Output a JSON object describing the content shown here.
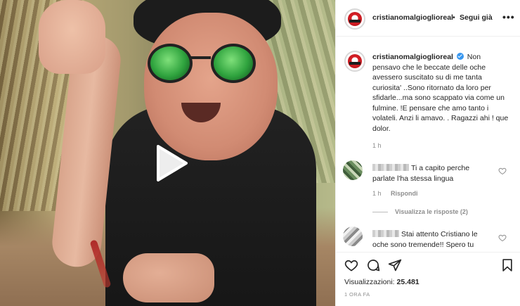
{
  "post": {
    "username": "cristianomalgioglioreal",
    "header_separator": "•",
    "follow_label": "Segui già",
    "more_label": "•••",
    "caption": "Non pensavo che le beccate delle oche avessero suscitato su di me tanta curiosita' ..Sono ritornato da loro per sfidarle...ma sono scappato via come un fulmine. !E pensare che amo tanto i volateli. Anzi li amavo. . Ragazzi ahi ! que dolor.",
    "caption_time": "1 h"
  },
  "comments": [
    {
      "text": "Ti a capito perche parlate l'ha stessa lingua",
      "time": "1 h",
      "reply_label": "Rispondi",
      "view_replies_label": "Visualizza le risposte (2)"
    },
    {
      "text": "Stai attento Cristiano le oche sono tremende!! Spero tu"
    }
  ],
  "footer": {
    "views_label": "Visualizzazioni:",
    "views_count": "25.481",
    "timestamp": "1 ORA FA"
  },
  "icons": {
    "play": "play-icon",
    "like": "heart-icon",
    "comment": "comment-icon",
    "share": "share-icon",
    "save": "bookmark-icon"
  },
  "colors": {
    "verified": "#3897f0",
    "muted_text": "#8e8e8e",
    "text": "#262626",
    "border": "#efefef"
  }
}
